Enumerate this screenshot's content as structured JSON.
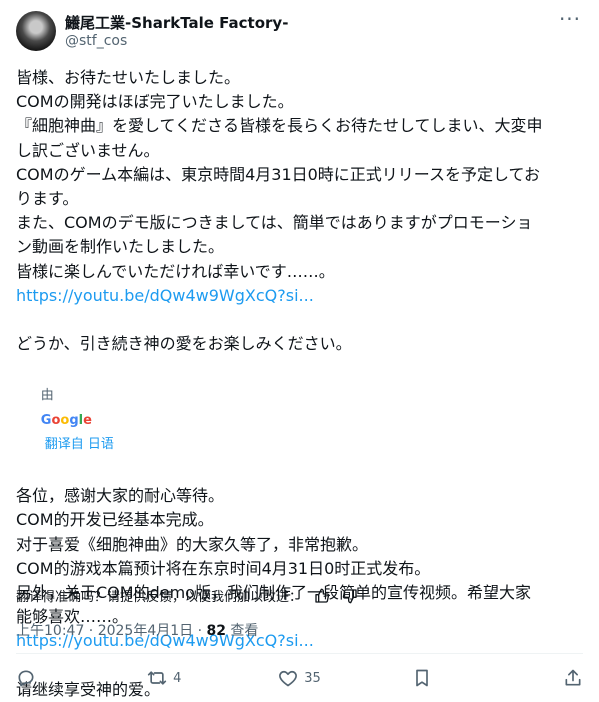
{
  "author": {
    "name": "鱶尾工業-SharkTale Factory-",
    "handle": "@stf_cos"
  },
  "tweet": {
    "original_lines": [
      "皆様、お待たせいたしました。",
      "COMの開発はほぼ完了いたしました。",
      "『細胞神曲』を愛してくださる皆様を長らくお待たせしてしまい、大変申",
      "し訳ございません。",
      "COMのゲーム本編は、東京時間4月31日0時に正式リリースを予定してお",
      "ります。",
      "また、COMのデモ版につきましては、簡単ではありますがプロモーショ",
      "ン動画を制作いたしました。",
      "皆様に楽しんでいただければ幸いです……。"
    ],
    "original_link": "https://youtu.be/dQw4w9WgXcQ?si...",
    "original_closing": "どうか、引き続き神の愛をお楽しみください。",
    "translation_by": "由",
    "translation_brand": "Google",
    "translation_source": "翻译自 日语",
    "translated_lines": [
      "各位，感谢大家的耐心等待。",
      "COM的开发已经基本完成。",
      "对于喜爱《细胞神曲》的大家久等了，非常抱歉。",
      "COM的游戏本篇预计将在东京时间4月31日0时正式发布。",
      "另外，关于COM的demo版，我们制作了一段简单的宣传视频。希望大家",
      "能够喜欢……。"
    ],
    "translated_link": "https://youtu.be/dQw4w9WgXcQ?si...",
    "translated_closing": "请继续享受神的爱。"
  },
  "feedback": {
    "prompt": "翻译得准确吗？请提供反馈，以便我们加以改进："
  },
  "meta": {
    "time_date": "上午10:47 · 2025年4月1日 · ",
    "views_count": "82",
    "views_label": " 查看"
  },
  "actions": {
    "reply_count": "",
    "retweet_count": "4",
    "like_count": "35"
  },
  "colors": {
    "link": "#1d9bf0",
    "muted": "#536471",
    "text": "#0f1419"
  },
  "icons": [
    "more-icon",
    "thumbs-up-icon",
    "thumbs-down-icon",
    "reply-icon",
    "retweet-icon",
    "like-icon",
    "bookmark-icon",
    "share-icon"
  ]
}
